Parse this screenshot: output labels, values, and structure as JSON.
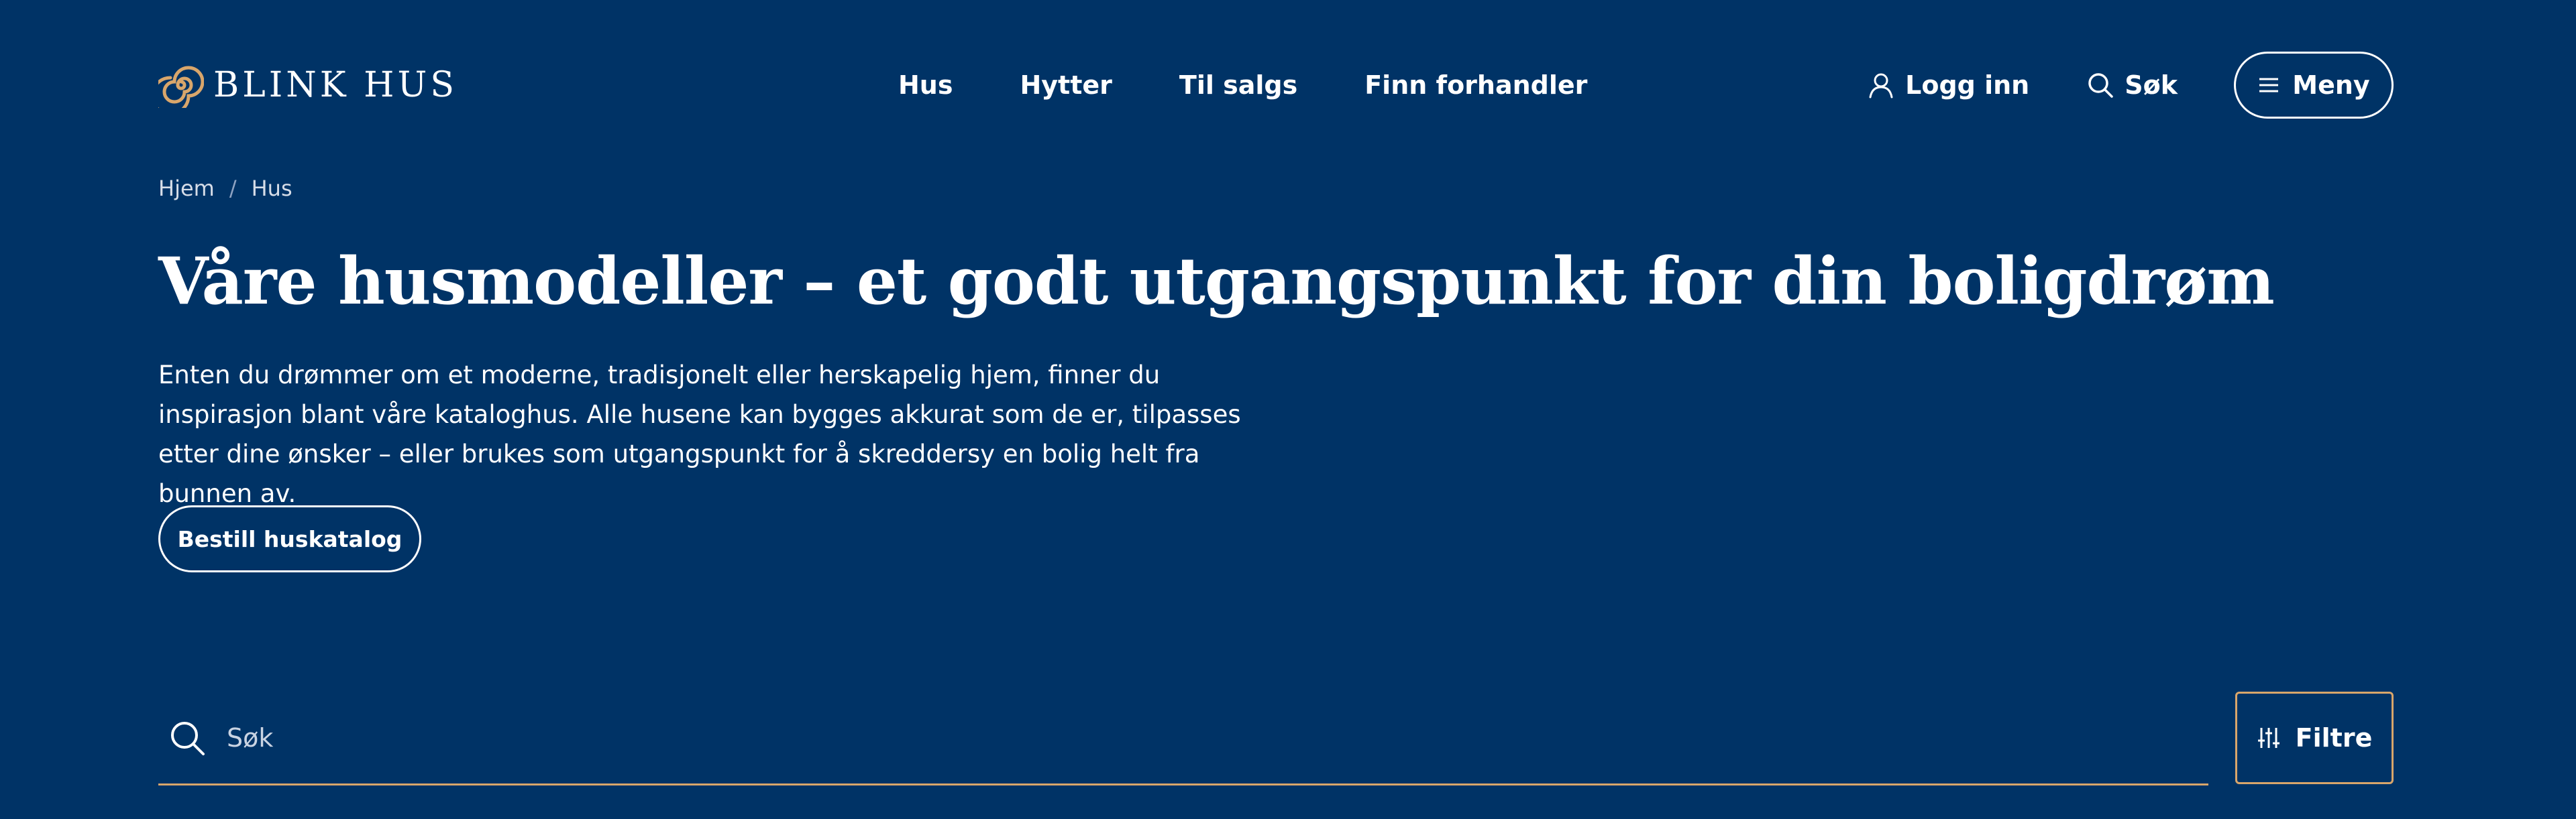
{
  "brand": {
    "name": "BLINK HUS",
    "accent": "#D9A66B",
    "background": "#003366"
  },
  "nav": {
    "items": [
      {
        "label": "Hus"
      },
      {
        "label": "Hytter"
      },
      {
        "label": "Til salgs"
      },
      {
        "label": "Finn forhandler"
      }
    ]
  },
  "actions": {
    "login_label": "Logg inn",
    "search_label": "Søk",
    "menu_label": "Meny"
  },
  "breadcrumb": {
    "home": "Hjem",
    "separator": "/",
    "current": "Hus"
  },
  "main": {
    "title": "Våre husmodeller – et godt utgangspunkt for din boligdrøm",
    "intro": "Enten du drømmer om et moderne, tradisjonelt eller herskapelig hjem, finner du inspirasjon blant våre kataloghus. Alle husene kan bygges akkurat som de er, tilpasses etter dine ønsker – eller brukes som utgangspunkt for å skreddersy en bolig helt fra bunnen av.",
    "catalog_button": "Bestill huskatalog"
  },
  "search": {
    "placeholder": "Søk",
    "filter_label": "Filtre"
  },
  "icons": [
    "spiral-logo-icon",
    "user-icon",
    "search-icon",
    "hamburger-icon",
    "search-icon",
    "sliders-icon"
  ]
}
